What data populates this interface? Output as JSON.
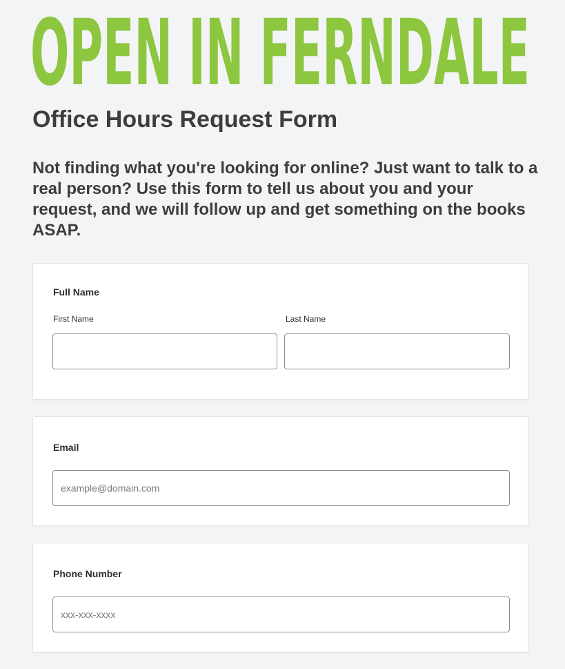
{
  "logo": {
    "text": "OPEN IN FERNDALE",
    "color": "#8dc63f"
  },
  "page": {
    "title": "Office Hours Request Form",
    "intro": "Not finding what you're looking for online? Just want to talk to a real person? Use this form to tell us about you and your request, and we will follow up and get something on the books ASAP."
  },
  "form": {
    "full_name": {
      "label": "Full Name",
      "first_name_label": "First Name",
      "first_name_value": "",
      "last_name_label": "Last Name",
      "last_name_value": ""
    },
    "email": {
      "label": "Email",
      "placeholder": "example@domain.com",
      "value": ""
    },
    "phone": {
      "label": "Phone Number",
      "placeholder": "xxx-xxx-xxxx",
      "value": ""
    }
  }
}
